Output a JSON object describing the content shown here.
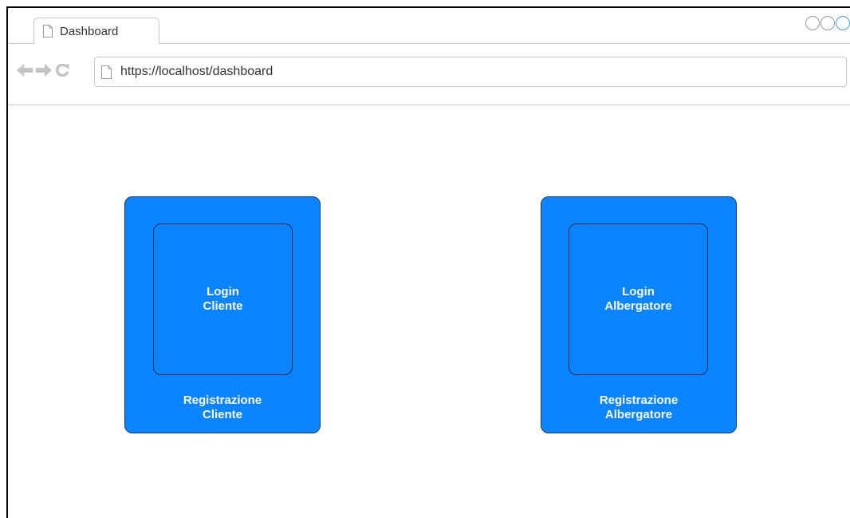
{
  "browser": {
    "tab_title": "Dashboard",
    "url": "https://localhost/dashboard",
    "icons": {
      "page": "document-icon",
      "back": "arrow-left-icon",
      "forward": "arrow-right-icon",
      "reload": "reload-icon",
      "window_controls": "circle-icon"
    }
  },
  "main": {
    "cards": [
      {
        "login_label": "Login\nCliente",
        "register_label": "Registrazione\nCliente"
      },
      {
        "login_label": "Login\nAlbergatore",
        "register_label": "Registrazione\nAlbergatore"
      }
    ]
  },
  "colors": {
    "card_background": "#0a84ff",
    "card_text": "#ffffff",
    "chrome_lines": "#c8c8c8"
  }
}
